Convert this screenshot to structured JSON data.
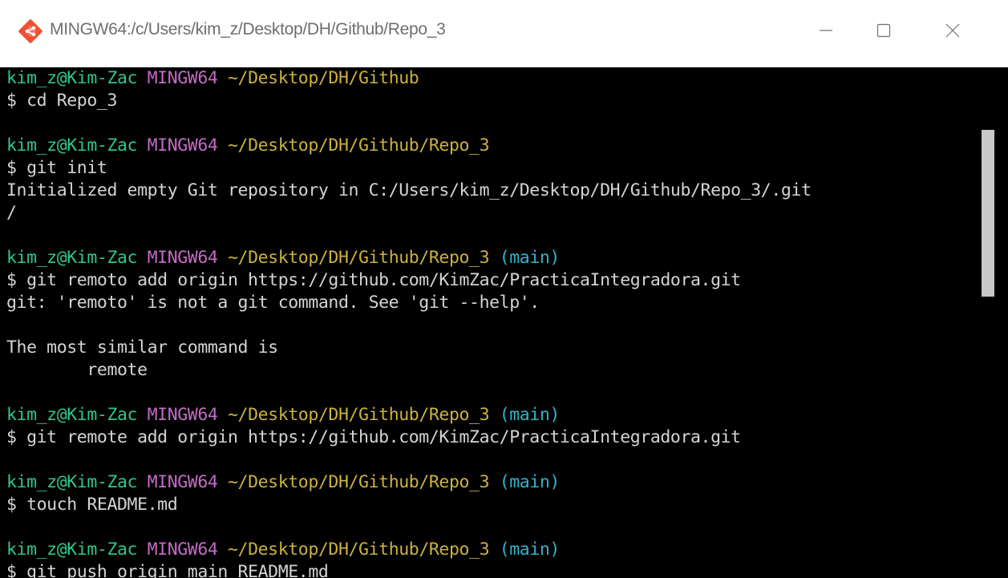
{
  "window": {
    "title": "MINGW64:/c/Users/kim_z/Desktop/DH/Github/Repo_3",
    "icon": "git-bash-icon",
    "controls": {
      "minimize_icon": "minimize-icon",
      "maximize_icon": "maximize-icon",
      "close_icon": "close-icon"
    }
  },
  "colors": {
    "user_host": "#2fc78a",
    "system": "#c46bc6",
    "path": "#cbb23f",
    "branch": "#33b2c9",
    "text": "#d4d4d4",
    "background": "#000000"
  },
  "terminal": {
    "lines": [
      {
        "type": "prompt",
        "user": "kim_z@Kim-Zac",
        "sys": "MINGW64",
        "path": "~/Desktop/DH/Github",
        "branch": ""
      },
      {
        "type": "text",
        "text": "$ cd Repo_3"
      },
      {
        "type": "blank",
        "text": ""
      },
      {
        "type": "prompt",
        "user": "kim_z@Kim-Zac",
        "sys": "MINGW64",
        "path": "~/Desktop/DH/Github/Repo_3",
        "branch": ""
      },
      {
        "type": "text",
        "text": "$ git init"
      },
      {
        "type": "text",
        "text": "Initialized empty Git repository in C:/Users/kim_z/Desktop/DH/Github/Repo_3/.git"
      },
      {
        "type": "text",
        "text": "/"
      },
      {
        "type": "blank",
        "text": ""
      },
      {
        "type": "prompt",
        "user": "kim_z@Kim-Zac",
        "sys": "MINGW64",
        "path": "~/Desktop/DH/Github/Repo_3",
        "branch": "(main)"
      },
      {
        "type": "text",
        "text": "$ git remoto add origin https://github.com/KimZac/PracticaIntegradora.git"
      },
      {
        "type": "text",
        "text": "git: 'remoto' is not a git command. See 'git --help'."
      },
      {
        "type": "blank",
        "text": ""
      },
      {
        "type": "text",
        "text": "The most similar command is"
      },
      {
        "type": "text",
        "text": "        remote"
      },
      {
        "type": "blank",
        "text": ""
      },
      {
        "type": "prompt",
        "user": "kim_z@Kim-Zac",
        "sys": "MINGW64",
        "path": "~/Desktop/DH/Github/Repo_3",
        "branch": "(main)"
      },
      {
        "type": "text",
        "text": "$ git remote add origin https://github.com/KimZac/PracticaIntegradora.git"
      },
      {
        "type": "blank",
        "text": ""
      },
      {
        "type": "prompt",
        "user": "kim_z@Kim-Zac",
        "sys": "MINGW64",
        "path": "~/Desktop/DH/Github/Repo_3",
        "branch": "(main)"
      },
      {
        "type": "text",
        "text": "$ touch README.md"
      },
      {
        "type": "blank",
        "text": ""
      },
      {
        "type": "prompt",
        "user": "kim_z@Kim-Zac",
        "sys": "MINGW64",
        "path": "~/Desktop/DH/Github/Repo_3",
        "branch": "(main)"
      },
      {
        "type": "text",
        "text": "$ git push origin main README.md"
      }
    ]
  }
}
